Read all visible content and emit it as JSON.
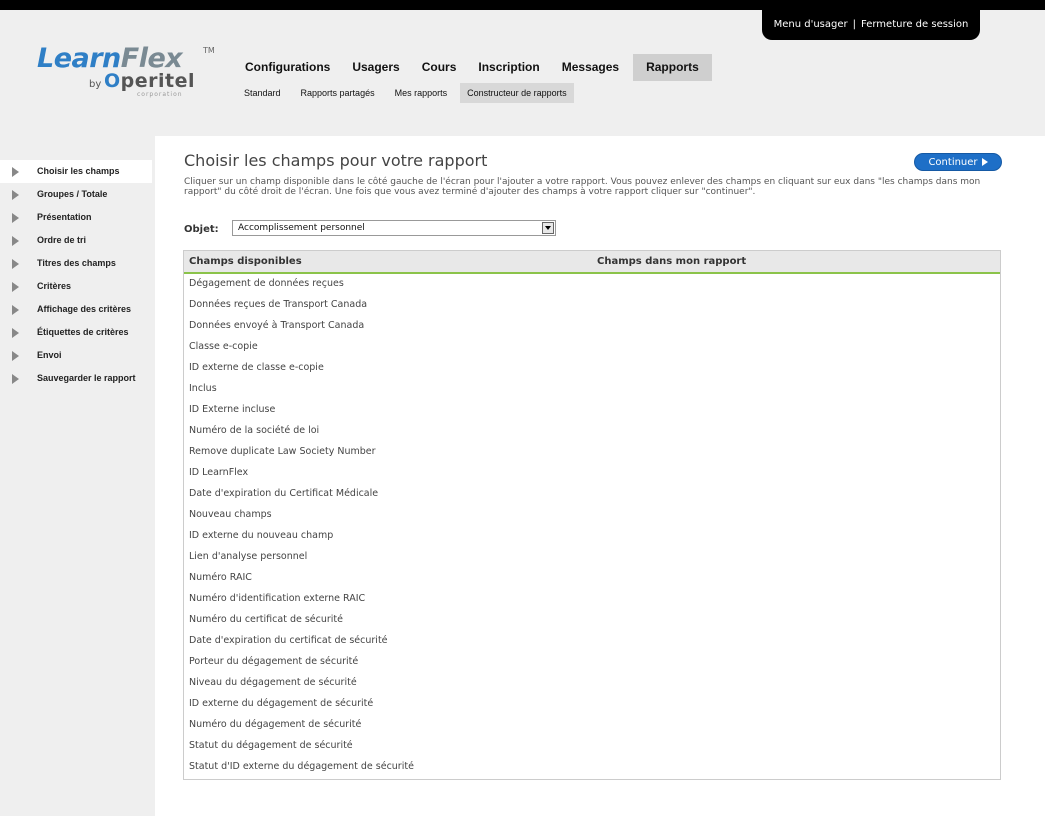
{
  "header": {
    "user_menu": "Menu d'usager",
    "separator": "|",
    "logout": "Fermeture de session",
    "logo": {
      "learn": "Learn",
      "flex": "Flex",
      "tm": "TM",
      "by": "by",
      "oper_o": "O",
      "oper_rest": "peritel",
      "corporation": "corporation"
    }
  },
  "nav": {
    "main": [
      "Configurations",
      "Usagers",
      "Cours",
      "Inscription",
      "Messages",
      "Rapports"
    ],
    "sub": [
      "Standard",
      "Rapports partagés",
      "Mes rapports",
      "Constructeur de rapports"
    ]
  },
  "sidebar": {
    "items": [
      "Choisir les champs",
      "Groupes / Totale",
      "Présentation",
      "Ordre de tri",
      "Titres des champs",
      "Critères",
      "Affichage des critères",
      "Étiquettes de critères",
      "Envoi",
      "Sauvegarder le rapport"
    ]
  },
  "page": {
    "title": "Choisir les champs pour votre rapport",
    "continue_label": "Continuer",
    "description": "Cliquer sur un champ disponible dans le côté gauche de l'écran pour l'ajouter a votre rapport. Vous pouvez enlever des champs en cliquant sur eux dans \"les champs dans mon rapport\" du côté droit de l'écran. Une fois que vous avez terminé d'ajouter des champs à votre rapport cliquer sur \"continuer\".",
    "object_label": "Objet:",
    "object_value": "Accomplissement personnel"
  },
  "fields": {
    "available_header": "Champs disponibles",
    "selected_header": "Champs dans mon rapport",
    "available": [
      "Dégagement de données reçues",
      "Données reçues de Transport Canada",
      "Données envoyé à Transport Canada",
      "Classe e-copie",
      "ID externe de classe e-copie",
      "Inclus",
      "ID Externe incluse",
      "Numéro de la société de loi",
      "Remove duplicate Law Society Number",
      "ID LearnFlex",
      "Date d'expiration du Certificat Médicale",
      "Nouveau champs",
      "ID externe du nouveau champ",
      "Lien d'analyse personnel",
      "Numéro RAIC",
      "Numéro d'identification externe RAIC",
      "Numéro du certificat de sécurité",
      "Date d'expiration du certificat de sécurité",
      "Porteur du dégagement de sécurité",
      "Niveau du dégagement de sécurité",
      "ID externe du dégagement de sécurité",
      "Numéro du dégagement de sécurité",
      "Statut du dégagement de sécurité",
      "Statut d'ID externe du dégagement de sécurité"
    ]
  }
}
